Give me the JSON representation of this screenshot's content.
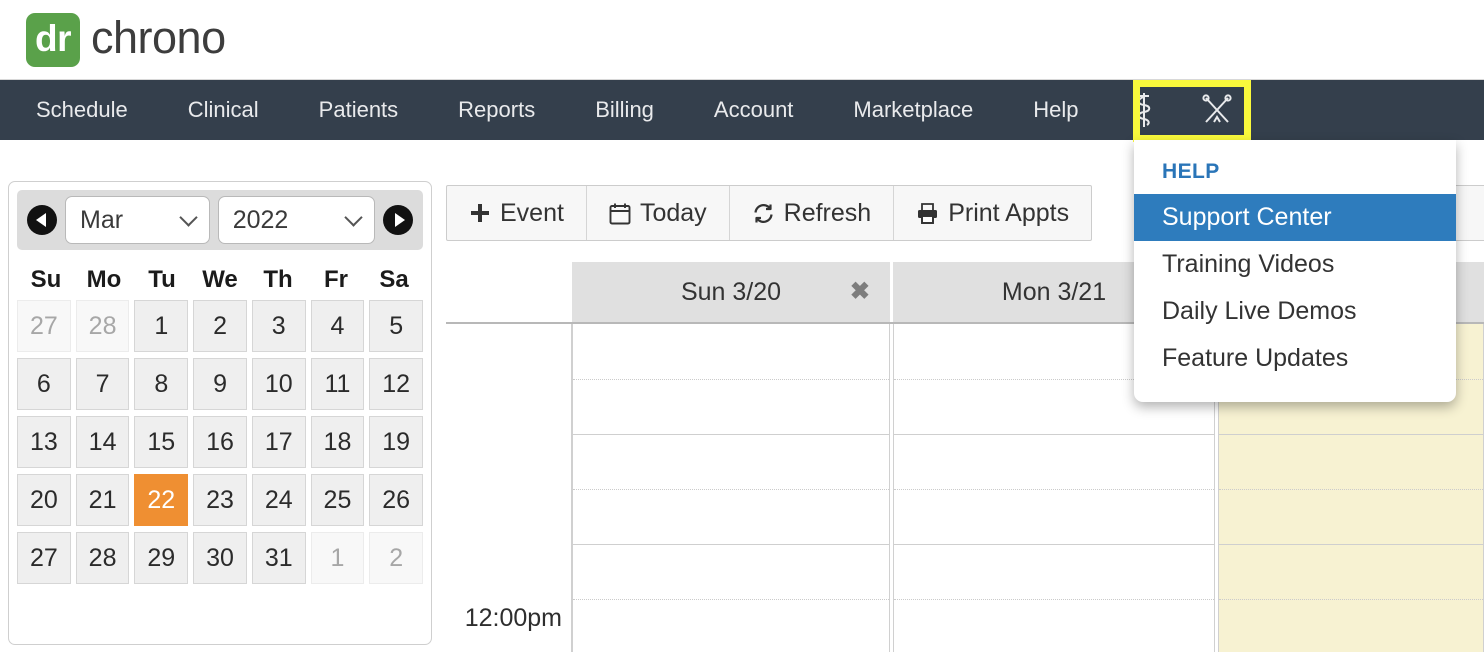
{
  "brand": {
    "badge_text": "dr",
    "word_text": "chrono"
  },
  "nav": {
    "items": [
      {
        "label": "Schedule",
        "name": "nav-item-schedule"
      },
      {
        "label": "Clinical",
        "name": "nav-item-clinical"
      },
      {
        "label": "Patients",
        "name": "nav-item-patients"
      },
      {
        "label": "Reports",
        "name": "nav-item-reports"
      },
      {
        "label": "Billing",
        "name": "nav-item-billing"
      },
      {
        "label": "Account",
        "name": "nav-item-account"
      },
      {
        "label": "Marketplace",
        "name": "nav-item-marketplace"
      },
      {
        "label": "Help",
        "name": "nav-item-help"
      }
    ],
    "icons": [
      "asclepius-rod-icon",
      "crossed-instruments-icon"
    ],
    "highlight_color": "#faf93c",
    "bar_color": "#343f4c"
  },
  "help_menu": {
    "title": "HELP",
    "items": [
      {
        "label": "Support Center",
        "active": true
      },
      {
        "label": "Training Videos",
        "active": false
      },
      {
        "label": "Daily Live Demos",
        "active": false
      },
      {
        "label": "Feature Updates",
        "active": false
      }
    ],
    "active_color": "#2e7cbd",
    "title_color": "#2a75b8"
  },
  "mini_calendar": {
    "month": "Mar",
    "year": "2022",
    "prev_label": "◀",
    "next_label": "▶",
    "dow": [
      "Su",
      "Mo",
      "Tu",
      "We",
      "Th",
      "Fr",
      "Sa"
    ],
    "today": 22,
    "today_color": "#ef8f32",
    "weeks": [
      [
        {
          "d": "27",
          "muted": true
        },
        {
          "d": "28",
          "muted": true
        },
        {
          "d": "1"
        },
        {
          "d": "2"
        },
        {
          "d": "3"
        },
        {
          "d": "4"
        },
        {
          "d": "5"
        }
      ],
      [
        {
          "d": "6"
        },
        {
          "d": "7"
        },
        {
          "d": "8"
        },
        {
          "d": "9"
        },
        {
          "d": "10"
        },
        {
          "d": "11"
        },
        {
          "d": "12"
        }
      ],
      [
        {
          "d": "13"
        },
        {
          "d": "14"
        },
        {
          "d": "15"
        },
        {
          "d": "16"
        },
        {
          "d": "17"
        },
        {
          "d": "18"
        },
        {
          "d": "19"
        }
      ],
      [
        {
          "d": "20"
        },
        {
          "d": "21"
        },
        {
          "d": "22",
          "today": true
        },
        {
          "d": "23"
        },
        {
          "d": "24"
        },
        {
          "d": "25"
        },
        {
          "d": "26"
        }
      ],
      [
        {
          "d": "27"
        },
        {
          "d": "28"
        },
        {
          "d": "29"
        },
        {
          "d": "30"
        },
        {
          "d": "31"
        },
        {
          "d": "1",
          "muted": true
        },
        {
          "d": "2",
          "muted": true
        }
      ]
    ]
  },
  "schedule_toolbar": {
    "buttons": [
      {
        "label": "Event",
        "icon": "plus-icon",
        "name": "add-event-button"
      },
      {
        "label": "Today",
        "icon": "calendar-icon",
        "name": "today-button"
      },
      {
        "label": "Refresh",
        "icon": "refresh-icon",
        "name": "refresh-button"
      },
      {
        "label": "Print Appts",
        "icon": "printer-icon",
        "name": "print-appts-button"
      }
    ]
  },
  "day_grid": {
    "columns": [
      {
        "label": "Sun 3/20",
        "closable": true,
        "is_today": false
      },
      {
        "label": "Mon 3/21",
        "closable": false,
        "is_today": false
      },
      {
        "label": "",
        "closable": false,
        "is_today": true
      }
    ],
    "time_labels": [
      "12:00pm"
    ],
    "today_bg": "#f7f2d2"
  }
}
